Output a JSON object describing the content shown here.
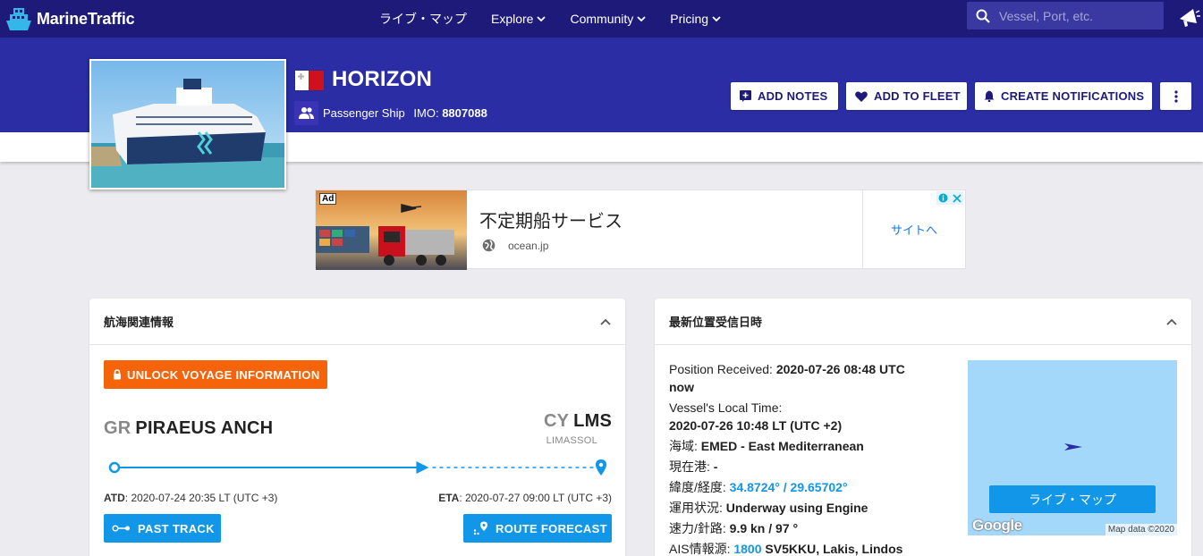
{
  "nav": {
    "brand": "MarineTraffic",
    "items": [
      {
        "label": "ライブ・マップ",
        "dropdown": false
      },
      {
        "label": "Explore",
        "dropdown": true
      },
      {
        "label": "Community",
        "dropdown": true
      },
      {
        "label": "Pricing",
        "dropdown": true
      }
    ],
    "search_placeholder": "Vessel, Port, etc.",
    "icons": [
      "search-icon",
      "megaphone-icon",
      "chevron-down-icon"
    ]
  },
  "vessel": {
    "name": "HORIZON",
    "flag": "Malta",
    "type": "Passenger Ship",
    "imo_label": "IMO:",
    "imo": "8807088"
  },
  "header_buttons": {
    "add_notes": "ADD NOTES",
    "add_to_fleet": "ADD TO FLEET",
    "create_notifications": "CREATE NOTIFICATIONS"
  },
  "ad": {
    "badge": "Ad",
    "title": "不定期船サービス",
    "url": "ocean.jp",
    "cta": "サイトへ"
  },
  "voyage": {
    "title": "航海関連情報",
    "unlock_label": "UNLOCK VOYAGE INFORMATION",
    "from_country": "GR",
    "from_port": "PIRAEUS ANCH",
    "to_country": "CY",
    "to_port": "LMS",
    "to_port_full": "LIMASSOL",
    "progress": 0.65,
    "atd_label": "ATD",
    "atd_value": ": 2020-07-24 20:35 LT (UTC +3)",
    "eta_label": "ETA",
    "eta_value": ": 2020-07-27 09:00 LT (UTC +3)",
    "past_track_label": "PAST TRACK",
    "route_forecast_label": "ROUTE FORECAST"
  },
  "position": {
    "title": "最新位置受信日時",
    "received_label": "Position Received: ",
    "received_value": "2020-07-26 08:48 UTC now",
    "local_time_label": "Vessel's Local Time:",
    "local_time_value": "2020-07-26 10:48 LT (UTC +2)",
    "area_label": "海域: ",
    "area_value": "EMED - East Mediterranean",
    "port_label": "現在港: ",
    "port_value": "-",
    "latlon_label": "緯度/経度: ",
    "latlon_value": "34.8724° / 29.65702°",
    "status_label": "運用状況: ",
    "status_value": "Underway using Engine",
    "speed_label": "速力/針路: ",
    "speed_value": "9.9 kn / 97 °",
    "ais_label": "AIS情報源: ",
    "ais_id": "1800",
    "ais_value": " SV5KKU, Lakis, Lindos",
    "map_button": "ライブ・マップ",
    "map_brand": "Google",
    "map_attr": "Map data ©2020"
  },
  "colors": {
    "nav_bg": "#1d1a7a",
    "header_bg": "#2a2da3",
    "accent_blue": "#1196e8",
    "unlock_orange": "#f5630a"
  }
}
